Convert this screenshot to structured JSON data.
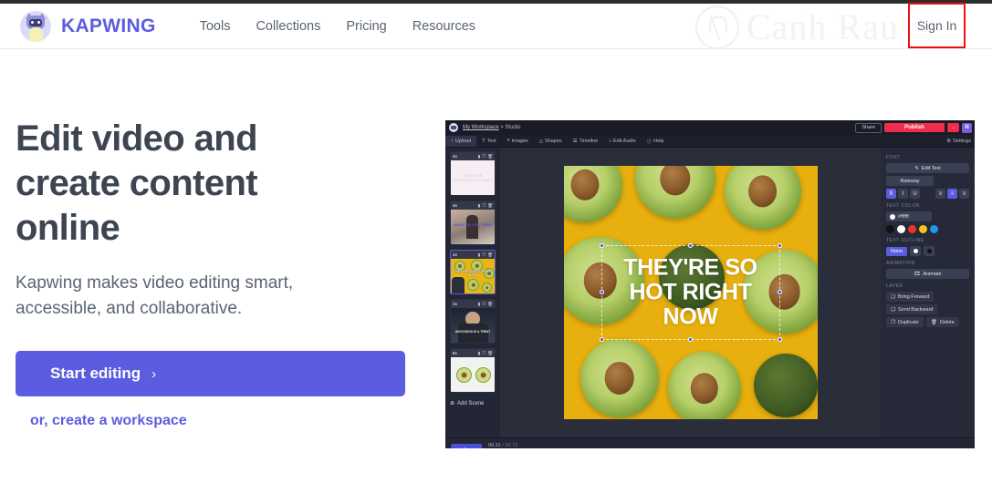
{
  "header": {
    "brand": "KAPWING",
    "logo_icon": "cat-avatar-icon",
    "nav": [
      {
        "label": "Tools"
      },
      {
        "label": "Collections"
      },
      {
        "label": "Pricing"
      },
      {
        "label": "Resources"
      }
    ],
    "signin_label": "Sign In",
    "highlight_color": "#ee1111"
  },
  "watermark": {
    "text": "Canh Rau"
  },
  "hero": {
    "title_line1": "Edit video and",
    "title_line2": "create content",
    "title_line3": "online",
    "subtitle_line1": "Kapwing makes video editing smart,",
    "subtitle_line2": "accessible, and collaborative.",
    "cta_label": "Start editing",
    "cta_arrow": "›",
    "cta_secondary": "or, create a workspace",
    "accent_color": "#5c5ce0"
  },
  "editor": {
    "breadcrumb_link": "My Workspace",
    "breadcrumb_sep": " > ",
    "breadcrumb_current": "Studio",
    "share_label": "Share",
    "publish_label": "Publish",
    "publish_caret": "⌄",
    "publish_color": "#f02e4c",
    "user_initial": "N",
    "settings_label": "Settings",
    "settings_icon": "gear-icon",
    "toolbar": [
      {
        "label": "Upload",
        "icon": "upload-icon",
        "glyph": "↑",
        "active": true
      },
      {
        "label": "Text",
        "icon": "text-icon",
        "glyph": "T",
        "active": false
      },
      {
        "label": "Images",
        "icon": "search-images-icon",
        "glyph": "⌕",
        "active": false
      },
      {
        "label": "Shapes",
        "icon": "shapes-icon",
        "glyph": "△",
        "active": false
      },
      {
        "label": "Timeline",
        "icon": "timeline-icon",
        "glyph": "☰",
        "active": false
      },
      {
        "label": "Edit Audio",
        "icon": "audio-note-icon",
        "glyph": "♪",
        "active": false
      },
      {
        "label": "Help",
        "icon": "help-icon",
        "glyph": "ⓘ",
        "active": false
      }
    ],
    "scenes": [
      {
        "duration": "4s",
        "caption": "WHAT ARE AVOCADOS ANYWAY?",
        "selected": false
      },
      {
        "duration": "4s",
        "caption": "WHAT DO YOU THINK",
        "selected": false
      },
      {
        "duration": "4s",
        "caption": "THEY'RE SO HOT RIGHT NOW",
        "selected": true
      },
      {
        "duration": "3s",
        "caption": "AVOCADOS IS A TREAT",
        "selected": false
      },
      {
        "duration": "8s",
        "caption": "",
        "selected": false
      }
    ],
    "scene_icons": {
      "transition": "transition-icon",
      "duplicate": "duplicate-icon",
      "delete": "trash-icon"
    },
    "add_scene_label": "Add Scene",
    "add_scene_icon": "plus-circle-icon",
    "canvas_text": "THEY'RE SO HOT RIGHT NOW",
    "panel": {
      "font_label": "FONT",
      "edit_text_label": "Edit Text",
      "edit_text_icon": "pencil-icon",
      "font_family": "Raleway",
      "bold": "B",
      "italic": "I",
      "underline": "U",
      "align_left_icon": "align-left-icon",
      "align_center_icon": "align-center-icon",
      "align_right_icon": "align-right-icon",
      "text_color_label": "TEXT COLOR",
      "text_color_value": "#ffffff",
      "swatches": [
        "#111111",
        "#ffffff",
        "#f42f2f",
        "#f5c518",
        "#2196f3"
      ],
      "text_outline_label": "TEXT OUTLINE",
      "outline_none_label": "None",
      "outline_options": [
        "#ffffff",
        "#111111"
      ],
      "animation_label": "ANIMATION",
      "animate_label": "Animate",
      "animate_icon": "film-icon",
      "layer_label": "LAYER",
      "bring_forward_label": "Bring Forward",
      "bring_forward_icon": "layer-up-icon",
      "send_backward_label": "Send Backward",
      "send_backward_icon": "layer-down-icon",
      "duplicate_label": "Duplicate",
      "duplicate_icon": "copy-icon",
      "delete_label": "Delete",
      "delete_icon": "trash-icon"
    },
    "player": {
      "play_icon": "play-icon",
      "play_glyph": "▶",
      "current_time": "09.31",
      "separator": " / ",
      "total_time": "24.72"
    }
  }
}
